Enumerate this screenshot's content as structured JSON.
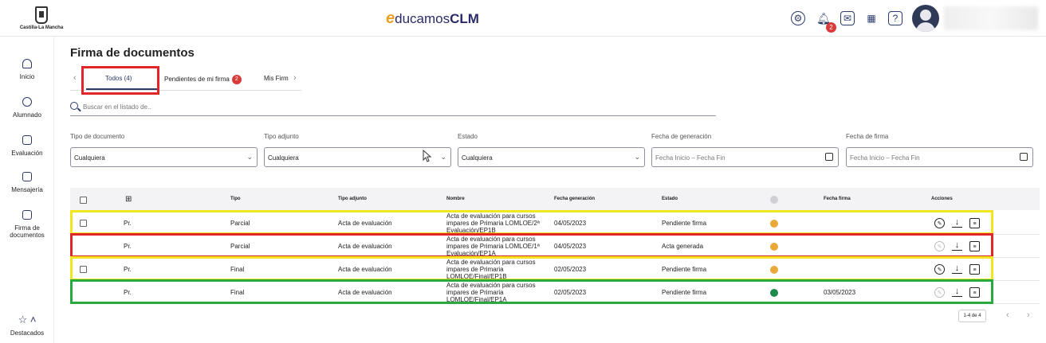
{
  "header": {
    "region_logo_text": "Castilla-La Mancha",
    "brand_e": "e",
    "brand_mid": "ducamos",
    "brand_clm": "CLM",
    "notifications_count": "2",
    "icons": [
      "gear-icon",
      "bell-icon",
      "mail-icon",
      "apps-icon",
      "help-icon"
    ]
  },
  "sidebar": {
    "items": [
      {
        "label": "Inicio",
        "icon": "home-icon"
      },
      {
        "label": "Alumnado",
        "icon": "person-icon"
      },
      {
        "label": "Evaluación",
        "icon": "edit-icon"
      },
      {
        "label": "Mensajería",
        "icon": "mail-icon"
      },
      {
        "label": "Firma de documentos",
        "icon": "sign-doc-icon"
      }
    ],
    "featured": {
      "label": "Destacados",
      "icon": "star-icon"
    }
  },
  "page": {
    "title": "Firma de documentos"
  },
  "tabs": [
    {
      "label": "Todos",
      "count": "(4)"
    },
    {
      "label": "Pendientes de mi firma",
      "badge": "2"
    },
    {
      "label": "Mis Firm"
    }
  ],
  "search": {
    "placeholder": "Buscar en el listado de.."
  },
  "filters": [
    {
      "label": "Tipo de documento",
      "value": "Cualquiera"
    },
    {
      "label": "Tipo adjunto",
      "value": "Cualquiera"
    },
    {
      "label": "Estado",
      "value": "Cualquiera"
    },
    {
      "label": "Fecha de generación",
      "value": "Fecha Inicio – Fecha Fin"
    },
    {
      "label": "Fecha de firma",
      "value": "Fecha Inicio – Fecha Fin"
    }
  ],
  "table": {
    "columns": [
      "Tipo",
      "Tipo adjunto",
      "Nombre",
      "Fecha generación",
      "Estado",
      "Fecha firma",
      "Acciones"
    ],
    "rows": [
      {
        "org": "Pr.",
        "tipo": "Parcial",
        "adjunto": "Acta de evaluación",
        "nombre": "Acta de evaluación para cursos impares de Primaria LOMLOE/2ª Evaluación/EP1B",
        "fecha_gen": "04/05/2023",
        "estado": "Pendiente firma",
        "fecha_firma": "",
        "dot_color": "#e8a93a",
        "checkbox": true,
        "sign_enabled": true
      },
      {
        "org": "Pr.",
        "tipo": "Parcial",
        "adjunto": "Acta de evaluación",
        "nombre": "Acta de evaluación para cursos impares de Primaria LOMLOE/1ª Evaluación/EP1A",
        "fecha_gen": "04/05/2023",
        "estado": "Acta generada",
        "fecha_firma": "",
        "dot_color": "#e8a93a",
        "checkbox": false,
        "sign_enabled": false
      },
      {
        "org": "Pr.",
        "tipo": "Final",
        "adjunto": "Acta de evaluación",
        "nombre": "Acta de evaluación para cursos impares de Primaria LOMLOE/Final/EP1B",
        "fecha_gen": "02/05/2023",
        "estado": "Pendiente firma",
        "fecha_firma": "",
        "dot_color": "#e8a93a",
        "checkbox": true,
        "sign_enabled": true
      },
      {
        "org": "Pr.",
        "tipo": "Final",
        "adjunto": "Acta de evaluación",
        "nombre": "Acta de evaluación para cursos impares de Primaria LOMLOE/Final/EP1A",
        "fecha_gen": "02/05/2023",
        "estado": "Pendiente firma",
        "fecha_firma": "03/05/2023",
        "dot_color": "#1e8a4c",
        "checkbox": false,
        "sign_enabled": false
      }
    ]
  },
  "pagination": {
    "label": "1-4 de 4"
  },
  "colors": {
    "highlight_red": "#e2242b",
    "highlight_yellow": "#f1e61f",
    "highlight_green": "#2aa940",
    "accent": "#2b3a6b",
    "badge": "#d93b3b"
  }
}
